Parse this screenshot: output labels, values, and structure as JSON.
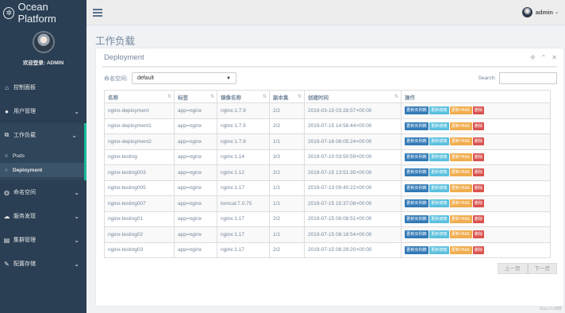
{
  "brand": {
    "title": "Ocean Platform",
    "logo_icon": "atom-icon"
  },
  "sidebar": {
    "welcome": "欢迎登录: ADMIN",
    "menu": [
      {
        "label": "控制面板",
        "icon": "home-icon",
        "chevron": false
      },
      {
        "label": "用户管理",
        "icon": "user-icon",
        "chevron": true
      },
      {
        "label": "工作负载",
        "icon": "sitemap-icon",
        "chevron": true,
        "active": true,
        "children": [
          {
            "label": "Pods"
          },
          {
            "label": "Deployment",
            "active": true
          }
        ]
      },
      {
        "label": "命名空间",
        "icon": "globe-icon",
        "chevron": true
      },
      {
        "label": "服务发现",
        "icon": "cloud-icon",
        "chevron": true
      },
      {
        "label": "集群管理",
        "icon": "server-icon",
        "chevron": true
      },
      {
        "label": "配置存储",
        "icon": "wrench-icon",
        "chevron": true
      }
    ]
  },
  "topbar": {
    "user": "admin"
  },
  "page": {
    "title": "工作负载"
  },
  "panel": {
    "title": "Deployment",
    "namespace_label": "命名空间:",
    "namespace_value": "default",
    "search_label": "Search:",
    "columns": [
      "名称",
      "标签",
      "镜像名称",
      "副本集",
      "创建时间",
      "操作"
    ],
    "actions": {
      "scale": "更新实例数",
      "image": "更新镜像",
      "yaml": "更新YAML",
      "delete": "删除"
    },
    "rows": [
      [
        "nginx-deployment",
        "app=nginx",
        "nginx:1.7.9",
        "2/2",
        "2019-03-15 03:28:57+00:00"
      ],
      [
        "nginx-deployment1",
        "app=nginx",
        "nginx:1.7.9",
        "2/2",
        "2019-07-15 14:56:44+00:00"
      ],
      [
        "nginx-deployment2",
        "app=nginx",
        "nginx:1.7.9",
        "1/1",
        "2019-07-16 08:05:24+00:00"
      ],
      [
        "nginx-testing",
        "app=nginx",
        "nginx:1.14",
        "3/3",
        "2019-07-10 03:50:59+00:00"
      ],
      [
        "nginx-testing003",
        "app=nginx",
        "nginx:1.12",
        "2/2",
        "2019-07-15 13:51:35+00:00"
      ],
      [
        "nginx-testing005",
        "app=nginx",
        "nginx:1.17",
        "1/1",
        "2019-07-13 09:40:22+00:00"
      ],
      [
        "nginx-testing007",
        "app=nginx",
        "tomcat:7.0.75",
        "1/1",
        "2019-07-15 15:37:08+00:00"
      ],
      [
        "nginx-testing01",
        "app=nginx",
        "nginx:1.17",
        "2/2",
        "2019-07-15 08:08:51+00:00"
      ],
      [
        "nginx-testing02",
        "app=nginx",
        "nginx:1.17",
        "1/1",
        "2019-07-15 08:18:54+00:00"
      ],
      [
        "nginx-testing03",
        "app=nginx",
        "nginx:1.17",
        "2/2",
        "2019-07-15 08:29:20+00:00"
      ]
    ],
    "pager": {
      "prev": "上一页",
      "next": "下一页"
    }
  },
  "footer_note": "@51CTO博客"
}
